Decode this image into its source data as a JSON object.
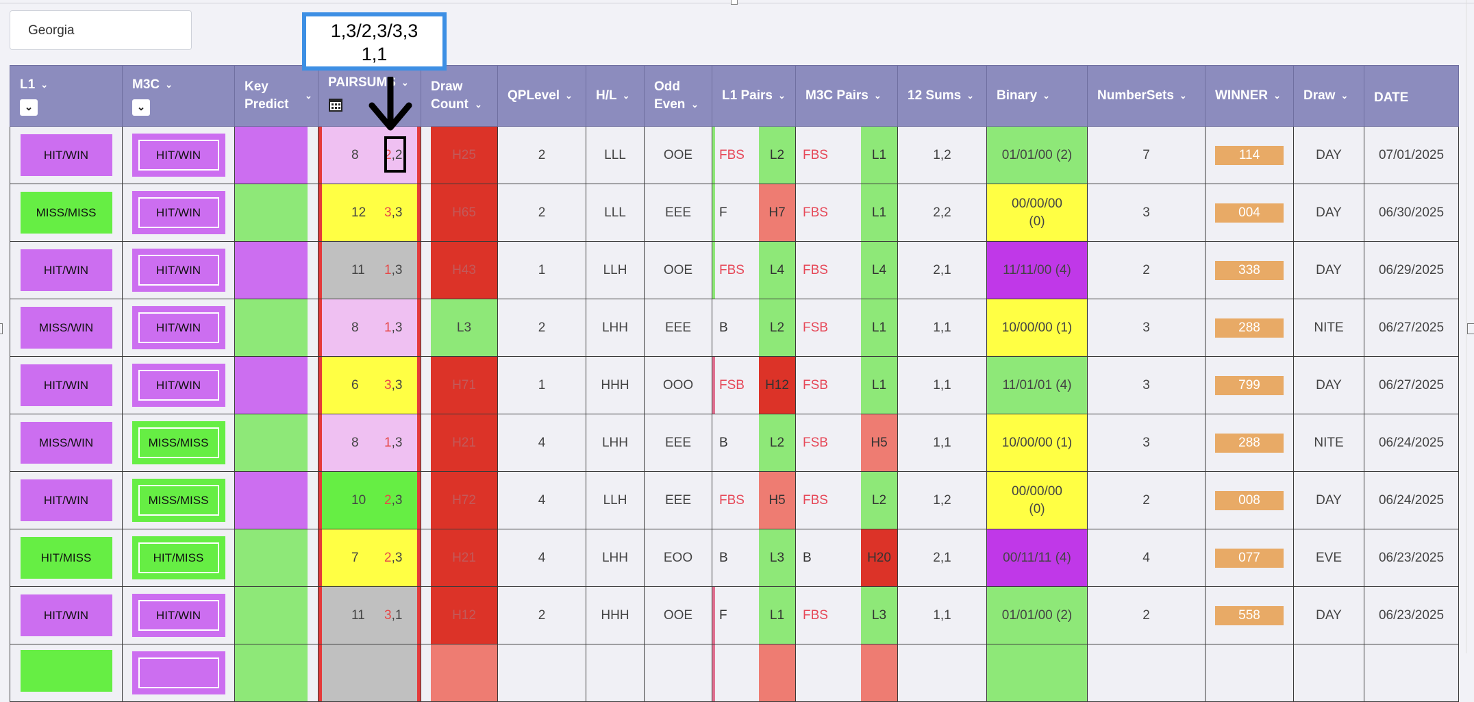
{
  "state_input": {
    "value": "Georgia"
  },
  "annotation": {
    "line1": "1,3/2,3/3,3",
    "line2": "1,1"
  },
  "headers": {
    "l1": "L1",
    "m3c": "M3C",
    "key_predict": "Key Predict",
    "pairsums": "PAIRSUMS",
    "draw_count": "Draw Count",
    "qplevel": "QPLevel",
    "hl": "H/L",
    "odd_even": "Odd Even",
    "l1_pairs": "L1 Pairs",
    "m3c_pairs": "M3C Pairs",
    "sums12": "12 Sums",
    "binary": "Binary",
    "numbersets": "NumberSets",
    "winner": "WINNER",
    "draw": "Draw",
    "date": "DATE"
  },
  "colors": {
    "purple": "#cc6ef0",
    "green": "#66ee44",
    "light_green": "#8ee878",
    "red": "#dc3328",
    "salmon": "#ee7c72",
    "yellow": "#ffff44",
    "pink": "#efc0f2",
    "gray": "#c0c0c0",
    "violet": "#c038e8",
    "orange": "#e8aa66",
    "header": "#8c8cbe"
  },
  "rows": [
    {
      "l1": "HIT/WIN",
      "l1c": "purple",
      "m3c": "HIT/WIN",
      "m3cc": "purple",
      "kp": "purple",
      "ps_fill": "pink",
      "ps1": "8",
      "ps2a": "2",
      "ps2b": ",2",
      "dc": "H25",
      "dcc": "red",
      "qp": "2",
      "hl": "LLL",
      "oe": "OOE",
      "lp_bar": "light_green",
      "l1pa": "FBS",
      "l1pa_red": true,
      "l1pb": "L2",
      "l1pbc": "light_green",
      "m3pa": "FBS",
      "m3pa_red": true,
      "m3pb": "L1",
      "m3pbc": "light_green",
      "s12": "1,2",
      "bin1": "01/01/00 (2)",
      "bin2": "",
      "binc": "light_green",
      "ns": "7",
      "win": "114",
      "draw": "DAY",
      "date": "07/01/2025"
    },
    {
      "l1": "MISS/MISS",
      "l1c": "green",
      "m3c": "HIT/WIN",
      "m3cc": "purple",
      "kp": "light_green",
      "ps_fill": "yellow",
      "ps1": "12",
      "ps2a": "3",
      "ps2b": ",3",
      "dc": "H65",
      "dcc": "red",
      "qp": "2",
      "hl": "LLL",
      "oe": "EEE",
      "lp_bar": "light_green",
      "l1pa": "F",
      "l1pa_red": false,
      "l1pb": "H7",
      "l1pbc": "salmon",
      "m3pa": "FBS",
      "m3pa_red": true,
      "m3pb": "L1",
      "m3pbc": "light_green",
      "s12": "2,2",
      "bin1": "00/00/00",
      "bin2": "(0)",
      "binc": "yellow",
      "ns": "3",
      "win": "004",
      "draw": "DAY",
      "date": "06/30/2025"
    },
    {
      "l1": "HIT/WIN",
      "l1c": "purple",
      "m3c": "HIT/WIN",
      "m3cc": "purple",
      "kp": "purple",
      "ps_fill": "gray",
      "ps1": "11",
      "ps2a": "1",
      "ps2b": ",3",
      "dc": "H43",
      "dcc": "red",
      "qp": "1",
      "hl": "LLH",
      "oe": "OOE",
      "lp_bar": "light_green",
      "l1pa": "FBS",
      "l1pa_red": true,
      "l1pb": "L4",
      "l1pbc": "light_green",
      "m3pa": "FBS",
      "m3pa_red": true,
      "m3pb": "L4",
      "m3pbc": "light_green",
      "s12": "2,1",
      "bin1": "11/11/00 (4)",
      "bin2": "",
      "binc": "violet",
      "ns": "2",
      "win": "338",
      "draw": "DAY",
      "date": "06/29/2025"
    },
    {
      "l1": "MISS/WIN",
      "l1c": "purple",
      "m3c": "HIT/WIN",
      "m3cc": "purple",
      "kp": "light_green",
      "ps_fill": "pink",
      "ps1": "8",
      "ps2a": "1",
      "ps2b": ",3",
      "dc": "L3",
      "dcc": "light_green",
      "qp": "2",
      "hl": "LHH",
      "oe": "EEE",
      "lp_bar": "none",
      "l1pa": "B",
      "l1pa_red": false,
      "l1pb": "L2",
      "l1pbc": "light_green",
      "m3pa": "FSB",
      "m3pa_red": true,
      "m3pb": "L1",
      "m3pbc": "light_green",
      "s12": "1,1",
      "bin1": "10/00/00 (1)",
      "bin2": "",
      "binc": "yellow",
      "ns": "3",
      "win": "288",
      "draw": "NITE",
      "date": "06/27/2025"
    },
    {
      "l1": "HIT/WIN",
      "l1c": "purple",
      "m3c": "HIT/WIN",
      "m3cc": "purple",
      "kp": "purple",
      "ps_fill": "yellow",
      "ps1": "6",
      "ps2a": "3",
      "ps2b": ",3",
      "dc": "H71",
      "dcc": "red",
      "qp": "1",
      "hl": "HHH",
      "oe": "OOO",
      "lp_bar": "rose",
      "l1pa": "FSB",
      "l1pa_red": true,
      "l1pb": "H12",
      "l1pbc": "red",
      "m3pa": "FSB",
      "m3pa_red": true,
      "m3pb": "L1",
      "m3pbc": "light_green",
      "s12": "1,1",
      "bin1": "11/01/01 (4)",
      "bin2": "",
      "binc": "light_green",
      "ns": "3",
      "win": "799",
      "draw": "DAY",
      "date": "06/27/2025"
    },
    {
      "l1": "MISS/WIN",
      "l1c": "purple",
      "m3c": "MISS/MISS",
      "m3cc": "green",
      "kp": "light_green",
      "ps_fill": "pink",
      "ps1": "8",
      "ps2a": "1",
      "ps2b": ",3",
      "dc": "H21",
      "dcc": "red",
      "qp": "4",
      "hl": "LHH",
      "oe": "EEE",
      "lp_bar": "none",
      "l1pa": "B",
      "l1pa_red": false,
      "l1pb": "L2",
      "l1pbc": "light_green",
      "m3pa": "FSB",
      "m3pa_red": true,
      "m3pb": "H5",
      "m3pbc": "salmon",
      "s12": "1,1",
      "bin1": "10/00/00 (1)",
      "bin2": "",
      "binc": "yellow",
      "ns": "3",
      "win": "288",
      "draw": "NITE",
      "date": "06/24/2025"
    },
    {
      "l1": "HIT/WIN",
      "l1c": "purple",
      "m3c": "MISS/MISS",
      "m3cc": "green",
      "kp": "purple",
      "ps_fill": "green",
      "ps1": "10",
      "ps2a": "2",
      "ps2b": ",3",
      "dc": "H72",
      "dcc": "red",
      "qp": "4",
      "hl": "LLH",
      "oe": "EEE",
      "lp_bar": "none",
      "l1pa": "FBS",
      "l1pa_red": true,
      "l1pb": "H5",
      "l1pbc": "salmon",
      "m3pa": "FBS",
      "m3pa_red": true,
      "m3pb": "L2",
      "m3pbc": "light_green",
      "s12": "1,2",
      "bin1": "00/00/00",
      "bin2": "(0)",
      "binc": "yellow",
      "ns": "2",
      "win": "008",
      "draw": "DAY",
      "date": "06/24/2025"
    },
    {
      "l1": "HIT/MISS",
      "l1c": "green",
      "m3c": "HIT/MISS",
      "m3cc": "green",
      "kp": "light_green",
      "ps_fill": "yellow",
      "ps1": "7",
      "ps2a": "2",
      "ps2b": ",3",
      "dc": "H21",
      "dcc": "red",
      "qp": "4",
      "hl": "LHH",
      "oe": "EOO",
      "lp_bar": "none",
      "l1pa": "B",
      "l1pa_red": false,
      "l1pb": "L3",
      "l1pbc": "light_green",
      "m3pa": "B",
      "m3pa_red": false,
      "m3pb": "H20",
      "m3pbc": "red",
      "s12": "2,1",
      "bin1": "00/11/11 (4)",
      "bin2": "",
      "binc": "violet",
      "ns": "4",
      "win": "077",
      "draw": "EVE",
      "date": "06/23/2025"
    },
    {
      "l1": "HIT/WIN",
      "l1c": "purple",
      "m3c": "HIT/WIN",
      "m3cc": "purple",
      "kp": "light_green",
      "ps_fill": "gray",
      "ps1": "11",
      "ps2a": "3",
      "ps2b": ",1",
      "dc": "H12",
      "dcc": "red",
      "qp": "2",
      "hl": "HHH",
      "oe": "OOE",
      "lp_bar": "rose",
      "l1pa": "F",
      "l1pa_red": false,
      "l1pb": "L1",
      "l1pbc": "light_green",
      "m3pa": "FBS",
      "m3pa_red": true,
      "m3pb": "L3",
      "m3pbc": "light_green",
      "s12": "1,1",
      "bin1": "01/01/00 (2)",
      "bin2": "",
      "binc": "light_green",
      "ns": "2",
      "win": "558",
      "draw": "DAY",
      "date": "06/23/2025"
    },
    {
      "l1": "",
      "l1c": "green",
      "m3c": "",
      "m3cc": "purple",
      "kp": "light_green",
      "ps_fill": "gray",
      "ps1": "",
      "ps2a": "",
      "ps2b": "",
      "dc": "",
      "dcc": "salmon",
      "qp": "",
      "hl": "",
      "oe": "",
      "lp_bar": "rose",
      "l1pa": "",
      "l1pa_red": false,
      "l1pb": "",
      "l1pbc": "salmon",
      "m3pa": "",
      "m3pa_red": false,
      "m3pb": "",
      "m3pbc": "salmon",
      "s12": "",
      "bin1": "",
      "bin2": "",
      "binc": "light_green",
      "ns": "",
      "win": "",
      "draw": "",
      "date": ""
    }
  ]
}
